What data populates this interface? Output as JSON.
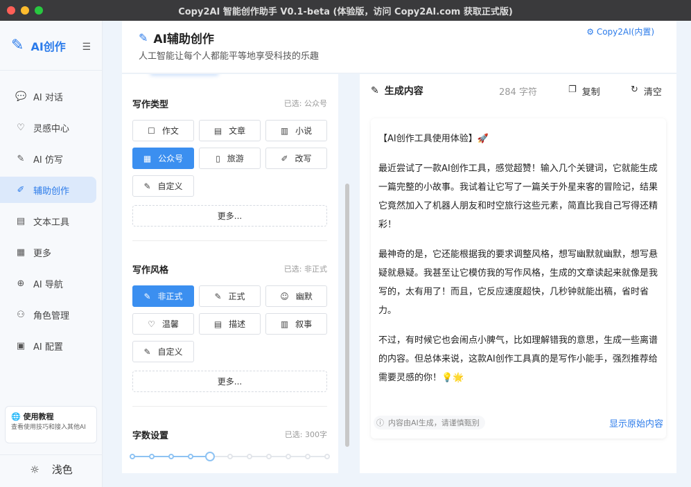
{
  "window": {
    "title": "Copy2AI 智能创作助手 V0.1-beta (体验版，访问 Copy2AI.com 获取正式版)"
  },
  "sidebar": {
    "logo": "AI创作",
    "items": [
      {
        "label": "AI 对话",
        "icon": "chat-icon"
      },
      {
        "label": "灵感中心",
        "icon": "lightbulb-icon"
      },
      {
        "label": "AI 仿写",
        "icon": "pen-icon"
      },
      {
        "label": "辅助创作",
        "icon": "brush-icon",
        "active": true
      },
      {
        "label": "文本工具",
        "icon": "document-icon"
      },
      {
        "label": "更多",
        "icon": "grid-icon"
      },
      {
        "label": "AI 导航",
        "icon": "globe-icon"
      },
      {
        "label": "角色管理",
        "icon": "users-icon"
      },
      {
        "label": "AI 配置",
        "icon": "settings-icon"
      }
    ],
    "tutorial": {
      "title": "使用教程",
      "subtitle": "查看使用技巧和接入其他AI"
    },
    "theme_label": "浅色"
  },
  "header": {
    "title": "AI辅助创作",
    "subtitle": "人工智能让每个人都能平等地享受科技的乐趣",
    "link": "Copy2AI(内置)"
  },
  "writing_type": {
    "title": "写作类型",
    "selected": "已选: 公众号",
    "options": [
      {
        "label": "作文",
        "icon": "edit-box-icon"
      },
      {
        "label": "文章",
        "icon": "file-icon"
      },
      {
        "label": "小说",
        "icon": "book-icon"
      },
      {
        "label": "公众号",
        "icon": "grid-icon",
        "active": true
      },
      {
        "label": "旅游",
        "icon": "phone-icon"
      },
      {
        "label": "改写",
        "icon": "eraser-icon"
      },
      {
        "label": "自定义",
        "icon": "pen-icon"
      }
    ],
    "more": "更多..."
  },
  "writing_style": {
    "title": "写作风格",
    "selected": "已选: 非正式",
    "options": [
      {
        "label": "非正式",
        "icon": "pen-icon",
        "active": true
      },
      {
        "label": "正式",
        "icon": "pen-icon"
      },
      {
        "label": "幽默",
        "icon": "smile-icon"
      },
      {
        "label": "温馨",
        "icon": "heart-icon"
      },
      {
        "label": "描述",
        "icon": "file-icon"
      },
      {
        "label": "叙事",
        "icon": "book-icon"
      },
      {
        "label": "自定义",
        "icon": "pen-icon"
      }
    ],
    "more": "更多..."
  },
  "word_count": {
    "title": "字数设置",
    "selected": "已选: 300字",
    "slider_steps": 11,
    "slider_value_step": 4
  },
  "output": {
    "title": "生成内容",
    "count": "284 字符",
    "copy_label": "复制",
    "clear_label": "清空",
    "paragraphs": [
      "【AI创作工具使用体验】🚀",
      "最近尝试了一款AI创作工具，感觉超赞！输入几个关键词，它就能生成一篇完整的小故事。我试着让它写了一篇关于外星来客的冒险记，结果它竟然加入了机器人朋友和时空旅行这些元素，简直比我自己写得还精彩！",
      "最神奇的是，它还能根据我的要求调整风格，想写幽默就幽默，想写悬疑就悬疑。我甚至让它模仿我的写作风格，生成的文章读起来就像是我写的，太有用了！而且，它反应速度超快，几秒钟就能出稿，省时省力。",
      "不过，有时候它也会闹点小脾气，比如理解错我的意思，生成一些离谱的内容。但总体来说，这款AI创作工具真的是写作小能手，强烈推荐给需要灵感的你！💡🌟"
    ],
    "footnote": "内容由AI生成，请谨慎甄别",
    "show_original": "显示原始内容"
  },
  "colors": {
    "accent": "#2b7bea",
    "active_option": "#3b8ff0"
  }
}
